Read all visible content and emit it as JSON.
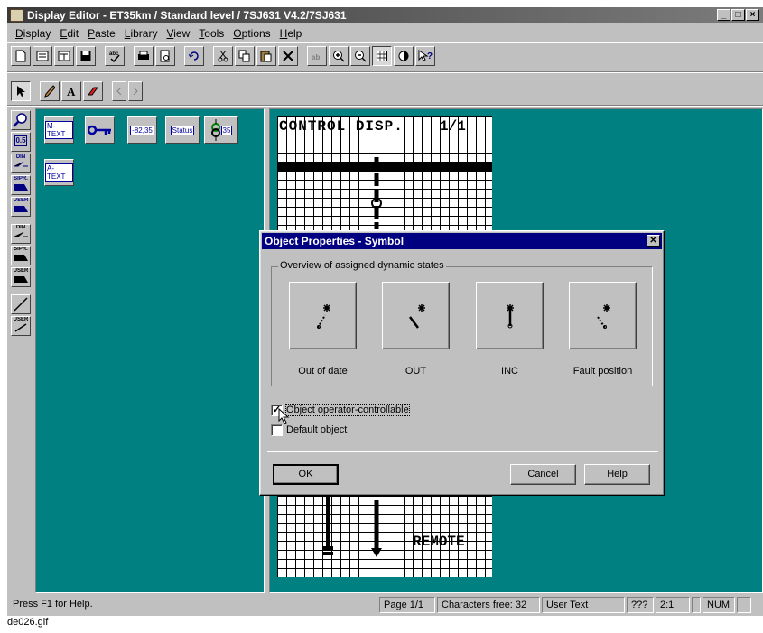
{
  "window": {
    "title": "Display Editor - ET35km / Standard level / 7SJ631 V4.2/7SJ631",
    "caption_buttons": [
      "_",
      "□",
      "×"
    ]
  },
  "menu": [
    "Display",
    "Edit",
    "Paste",
    "Library",
    "View",
    "Tools",
    "Options",
    "Help"
  ],
  "toolbar1": [
    "new-icon",
    "display-icon",
    "display2-icon",
    "save-icon",
    "spellcheck-icon",
    "print-icon",
    "print-preview-icon",
    "undo-icon",
    "cut-icon",
    "copy-icon",
    "paste-icon",
    "delete-icon",
    "text-icon",
    "zoom-in-icon",
    "zoom-out-icon",
    "grid-icon",
    "contrast-icon",
    "help-pointer-icon"
  ],
  "toolbar2": [
    "pointer-icon",
    "pencil-icon",
    "text-a-icon",
    "eraser-icon",
    "scroll-left-icon",
    "scroll-right-icon"
  ],
  "left_tools": [
    "zoom-icon",
    "0.5",
    "DIN",
    "SIPR.",
    "USER",
    "DIN",
    "SIPR.",
    "USER",
    "line-icon",
    "USER"
  ],
  "library": {
    "items": [
      {
        "label": "M-TEXT",
        "icon": "m-text-icon"
      },
      {
        "label": "",
        "icon": "key-icon"
      },
      {
        "label": "-82,35",
        "icon": "measure-icon"
      },
      {
        "label": "Status",
        "icon": "status-icon"
      },
      {
        "label": "35",
        "icon": "transformer-icon"
      },
      {
        "label": "A-TEXT",
        "icon": "a-text-icon"
      }
    ]
  },
  "canvas": {
    "title_left": "CONTROL DISP.",
    "title_right": "1/1",
    "bottom_label": "REMOTE"
  },
  "dialog": {
    "title": "Object Properties - Symbol",
    "group_label": "Overview of assigned dynamic states",
    "states": [
      {
        "label": "Out of date",
        "icon": "switch-dotted-icon"
      },
      {
        "label": "OUT",
        "icon": "switch-open-icon"
      },
      {
        "label": "INC",
        "icon": "switch-closed-icon"
      },
      {
        "label": "Fault position",
        "icon": "switch-fault-icon"
      }
    ],
    "checkbox_controllable": {
      "label": "Object operator-controllable",
      "checked": true
    },
    "checkbox_default": {
      "label": "Default object",
      "checked": false
    },
    "buttons": {
      "ok": "OK",
      "cancel": "Cancel",
      "help": "Help"
    }
  },
  "statusbar": {
    "help": "Press F1 for Help.",
    "page": "Page 1/1",
    "chars_free": "Characters free: 32",
    "mode": "User Text",
    "q": "???",
    "ratio": "2:1",
    "blank": "",
    "num": "NUM"
  },
  "image_caption": "de026.gif"
}
